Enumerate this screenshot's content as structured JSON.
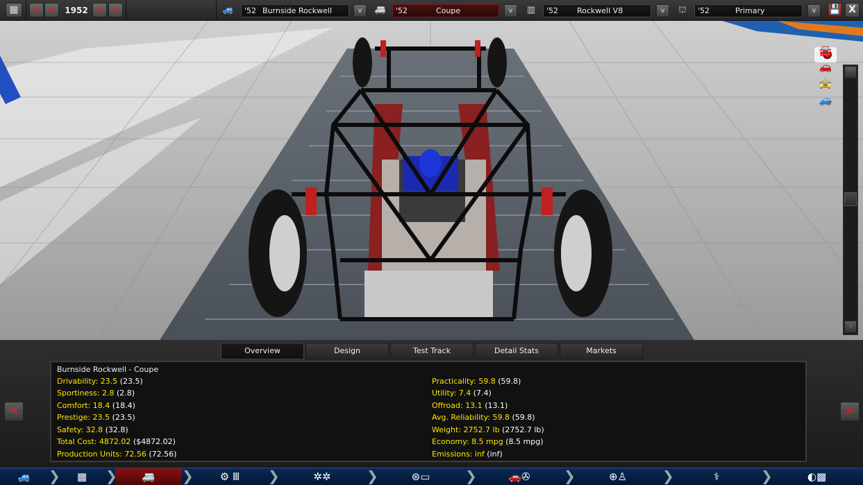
{
  "topbar": {
    "year": "1952",
    "prev_label": "<",
    "prev2_label": "<",
    "next_label": ">",
    "next2_label": ">",
    "model": {
      "year": "'52",
      "name": "Burnside Rockwell"
    },
    "trim": {
      "year": "'52",
      "name": "Coupe"
    },
    "engine": {
      "year": "'52",
      "name": "Rockwell V8"
    },
    "variant": {
      "year": "'52",
      "name": "Primary"
    },
    "dropdown_label": "v",
    "close_label": "X"
  },
  "viewport": {
    "scroll_up": "^",
    "scroll_down": "v",
    "view_icons": [
      "camera-icon",
      "car-front-icon",
      "car-side-icon",
      "car-rear-icon",
      "car-top-icon"
    ]
  },
  "tabs": [
    {
      "label": "Overview",
      "active": true
    },
    {
      "label": "Design",
      "active": false
    },
    {
      "label": "Test Track",
      "active": false
    },
    {
      "label": "Detail Stats",
      "active": false
    },
    {
      "label": "Markets",
      "active": false
    }
  ],
  "stats": {
    "title": "Burnside Rockwell - Coupe",
    "left": [
      {
        "key": "Drivability:",
        "value": "23.5",
        "paren": "(23.5)"
      },
      {
        "key": "Sportiness:",
        "value": "2.8",
        "paren": "(2.8)"
      },
      {
        "key": "Comfort:",
        "value": "18.4",
        "paren": "(18.4)"
      },
      {
        "key": "Prestige:",
        "value": "23.5",
        "paren": "(23.5)"
      },
      {
        "key": "Safety:",
        "value": "32.8",
        "paren": "(32.8)"
      },
      {
        "key": "Total Cost:",
        "value": "4872.02",
        "paren": "($4872.02)"
      },
      {
        "key": "Production Units:",
        "value": "72.56",
        "paren": "(72.56)"
      }
    ],
    "right": [
      {
        "key": "Practicality:",
        "value": "59.8",
        "paren": "(59.8)"
      },
      {
        "key": "Utility:",
        "value": "7.4",
        "paren": "(7.4)"
      },
      {
        "key": "Offroad:",
        "value": "13.1",
        "paren": "(13.1)"
      },
      {
        "key": "Avg. Reliability:",
        "value": "59.8",
        "paren": "(59.8)"
      },
      {
        "key": "Weight:",
        "value": "2752.7 lb",
        "paren": "(2752.7 lb)"
      },
      {
        "key": "Economy:",
        "value": "8.5 mpg",
        "paren": "(8.5 mpg)"
      },
      {
        "key": "Emissions:",
        "value": "inf",
        "paren": "(inf)"
      }
    ]
  },
  "panel": {
    "left_arrow": "<",
    "right_arrow": ">"
  },
  "bottomnav": [
    {
      "icon": "car-model-icon",
      "glyph": "🚙"
    },
    {
      "icon": "chassis-icon",
      "glyph": "▦"
    },
    {
      "icon": "body-icon",
      "glyph": "🚐"
    },
    {
      "icon": "engine-gearbox-icon",
      "glyph": "⚙ Ⅲ"
    },
    {
      "icon": "wheels-icon",
      "glyph": "✲✲"
    },
    {
      "icon": "brakes-icon",
      "glyph": "⊛▭"
    },
    {
      "icon": "aero-icon",
      "glyph": "🚗✇"
    },
    {
      "icon": "interior-icon",
      "glyph": "⊕♙"
    },
    {
      "icon": "suspension-icon",
      "glyph": "⚕"
    },
    {
      "icon": "finish-icon",
      "glyph": "◐▩"
    }
  ]
}
